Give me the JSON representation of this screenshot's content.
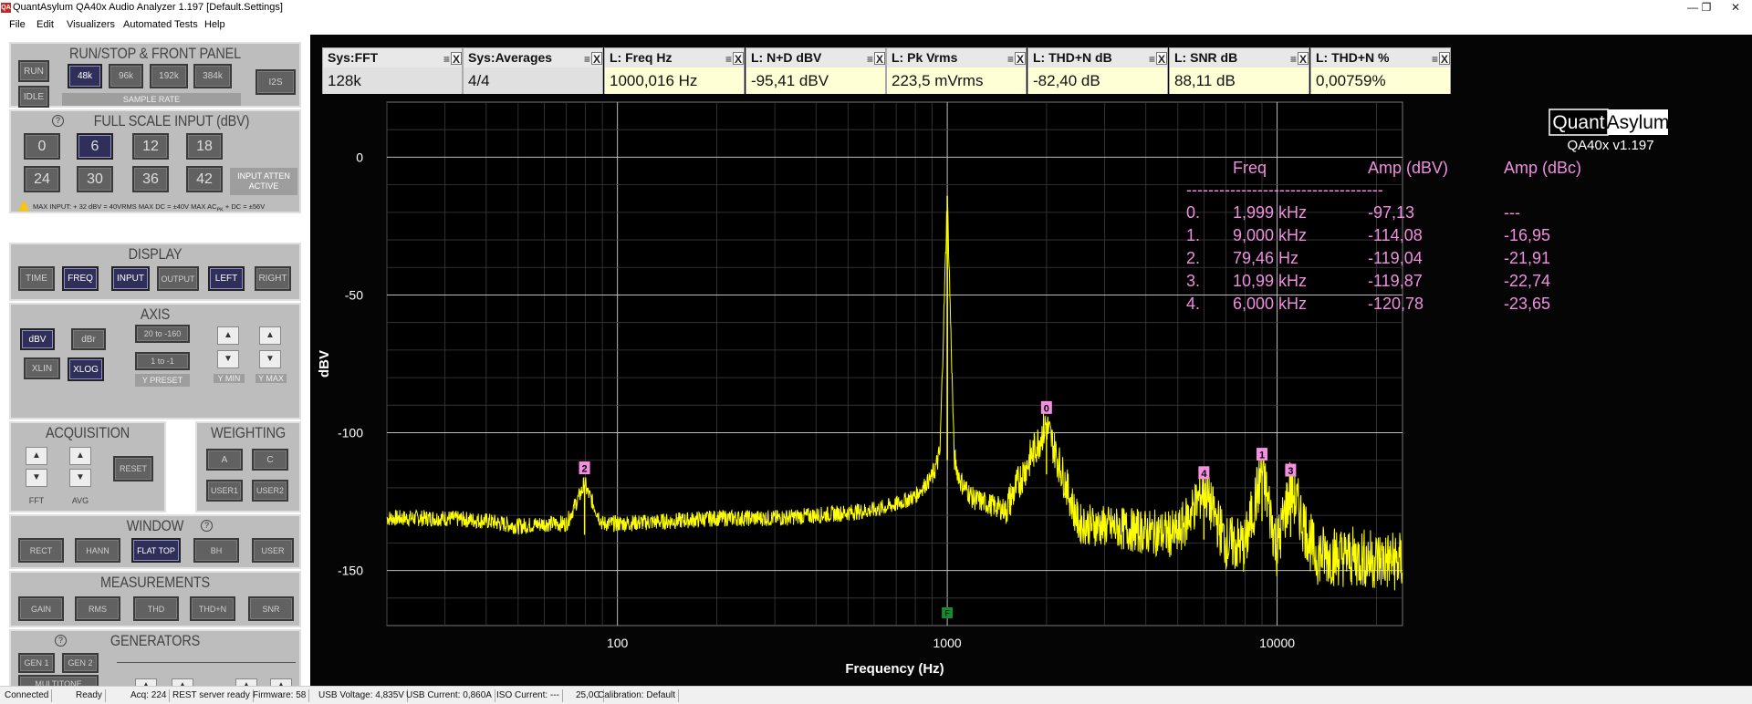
{
  "window": {
    "app_icon_text": "QA",
    "title": "QuantAsylum QA40x Audio Analyzer 1.197 [Default.Settings]",
    "minimize": "—",
    "maximize": "❐",
    "close": "✕"
  },
  "menu": [
    "File",
    "Edit",
    "Visualizers",
    "Automated Tests",
    "Help"
  ],
  "panel": {
    "run_stop": {
      "title": "RUN/STOP & FRONT PANEL",
      "run": "RUN",
      "idle": "IDLE",
      "rates": [
        "48k",
        "96k",
        "192k",
        "384k"
      ],
      "selected_rate": "48k",
      "i2s": "I2S",
      "sample_rate_label": "SAMPLE RATE"
    },
    "full_scale": {
      "title": "FULL SCALE INPUT (dBV)",
      "help": "?",
      "values": [
        "0",
        "6",
        "12",
        "18",
        "24",
        "30",
        "36",
        "42"
      ],
      "selected": "6",
      "atten_line1": "INPUT ATTEN",
      "atten_line2": "ACTIVE",
      "warning_icon": "!",
      "warning": "MAX INPUT: + 32 dBV = 40VRMS     MAX DC = ±40V     MAX AC",
      "warning_sub": "PK",
      "warning_tail": " + DC = ±56V"
    },
    "display": {
      "title": "DISPLAY",
      "buttons": [
        "TIME",
        "FREQ",
        "INPUT",
        "OUTPUT",
        "LEFT",
        "RIGHT"
      ],
      "selected": [
        "FREQ",
        "INPUT",
        "LEFT"
      ]
    },
    "axis": {
      "title": "AXIS",
      "dbv": "dBV",
      "dbr": "dBr",
      "xlin": "XLIN",
      "xlog": "XLOG",
      "preset1": "20 to -160",
      "preset2": "1 to -1",
      "y_preset": "Y PRESET",
      "y_min": "Y MIN",
      "y_max": "Y MAX",
      "up": "▲",
      "down": "▼"
    },
    "acquisition": {
      "title": "ACQUISITION",
      "reset": "RESET",
      "fft": "FFT",
      "avg": "AVG",
      "up": "▲",
      "down": "▼"
    },
    "weighting": {
      "title": "WEIGHTING",
      "buttons": [
        "A",
        "C",
        "USER1",
        "USER2"
      ]
    },
    "window_sect": {
      "title": "WINDOW",
      "help": "?",
      "buttons": [
        "RECT",
        "HANN",
        "FLAT TOP",
        "BH",
        "USER"
      ],
      "selected": "FLAT TOP"
    },
    "measurements": {
      "title": "MEASUREMENTS",
      "buttons": [
        "GAIN",
        "RMS",
        "THD",
        "THD+N",
        "SNR"
      ]
    },
    "generators": {
      "title": "GENERATORS",
      "help": "?",
      "gen1": "GEN 1",
      "gen2": "GEN 2",
      "multitone": "MULTITONE",
      "up": "▲",
      "down": "▼"
    }
  },
  "meters": [
    {
      "name": "Sys:FFT",
      "value": "128k",
      "highlight": false
    },
    {
      "name": "Sys:Averages",
      "value": "4/4",
      "highlight": false
    },
    {
      "name": "L: Freq Hz",
      "value": "1000,016 Hz",
      "highlight": true
    },
    {
      "name": "L: N+D dBV",
      "value": "-95,41 dBV",
      "highlight": true
    },
    {
      "name": "L: Pk Vrms",
      "value": "223,5 mVrms",
      "highlight": true
    },
    {
      "name": "L: THD+N dB",
      "value": "-82,40 dB",
      "highlight": true
    },
    {
      "name": "L: SNR dB",
      "value": "88,11 dB",
      "highlight": true
    },
    {
      "name": "L: THD+N %",
      "value": "0,00759%",
      "highlight": true
    }
  ],
  "meter_ctl": {
    "menu": "≡",
    "close": "X"
  },
  "plot": {
    "logo_left": "Quant",
    "logo_right": "Asylum",
    "version": "QA40x v1.197",
    "fundamental_marker": "F",
    "harmonics_table": {
      "headers": [
        "Freq",
        "Amp (dBV)",
        "Amp (dBc)"
      ],
      "separator": "------------------------------------",
      "rows": [
        {
          "idx": "0.",
          "freq": "1,999 kHz",
          "dbv": "-97,13",
          "dbc": "---"
        },
        {
          "idx": "1.",
          "freq": "9,000 kHz",
          "dbv": "-114,08",
          "dbc": "-16,95"
        },
        {
          "idx": "2.",
          "freq": "79,46 Hz",
          "dbv": "-119,04",
          "dbc": "-21,91"
        },
        {
          "idx": "3.",
          "freq": "10,99 kHz",
          "dbv": "-119,87",
          "dbc": "-22,74"
        },
        {
          "idx": "4.",
          "freq": "6,000 kHz",
          "dbv": "-120,78",
          "dbc": "-23,65"
        }
      ]
    }
  },
  "chart_data": {
    "type": "line",
    "xlabel": "Frequency (Hz)",
    "ylabel": "dBV",
    "x_scale": "log",
    "xlim": [
      20,
      24000
    ],
    "ylim": [
      -170,
      20
    ],
    "x_ticks": [
      100,
      1000,
      10000
    ],
    "x_tick_labels": [
      "100",
      "1000",
      "10000"
    ],
    "y_ticks": [
      0,
      -50,
      -100,
      -150
    ],
    "y_tick_labels": [
      "0",
      "-50",
      "-100",
      "-150"
    ],
    "grid": true,
    "line_color": "#ffff00",
    "series": [
      {
        "points": [
          [
            20,
            -131
          ],
          [
            30,
            -131
          ],
          [
            40,
            -132
          ],
          [
            50,
            -134
          ],
          [
            60,
            -133
          ],
          [
            70,
            -133
          ],
          [
            79.46,
            -119.04
          ],
          [
            90,
            -133
          ],
          [
            100,
            -133
          ],
          [
            150,
            -132
          ],
          [
            200,
            -131
          ],
          [
            300,
            -131
          ],
          [
            400,
            -130
          ],
          [
            500,
            -129
          ],
          [
            600,
            -128
          ],
          [
            700,
            -126
          ],
          [
            800,
            -123
          ],
          [
            900,
            -116
          ],
          [
            950,
            -108
          ],
          [
            1000,
            -14
          ],
          [
            1050,
            -110
          ],
          [
            1100,
            -118
          ],
          [
            1200,
            -124
          ],
          [
            1500,
            -128
          ],
          [
            1999,
            -97.13
          ],
          [
            2500,
            -133
          ],
          [
            3000,
            -134
          ],
          [
            4000,
            -136
          ],
          [
            5000,
            -137
          ],
          [
            6000,
            -120.78
          ],
          [
            7000,
            -140
          ],
          [
            8000,
            -141
          ],
          [
            9000,
            -114.08
          ],
          [
            10000,
            -142
          ],
          [
            10990,
            -119.87
          ],
          [
            13000,
            -144
          ],
          [
            16000,
            -145
          ],
          [
            20000,
            -146
          ],
          [
            24000,
            -147
          ]
        ]
      }
    ],
    "harmonic_markers": [
      {
        "label": "0",
        "freq": 1999,
        "amp": -97.13
      },
      {
        "label": "1",
        "freq": 9000,
        "amp": -114.08
      },
      {
        "label": "2",
        "freq": 79.46,
        "amp": -119.04
      },
      {
        "label": "3",
        "freq": 10990,
        "amp": -119.87
      },
      {
        "label": "4",
        "freq": 6000,
        "amp": -120.78
      }
    ]
  },
  "status": [
    "Connected",
    "Ready",
    "Acq: 224",
    "REST server ready",
    "Firmware: 58",
    "USB Voltage: 4,835V",
    "USB Current: 0,860A",
    "ISO Current: ---",
    "25,0C",
    "Calibration: Default"
  ]
}
